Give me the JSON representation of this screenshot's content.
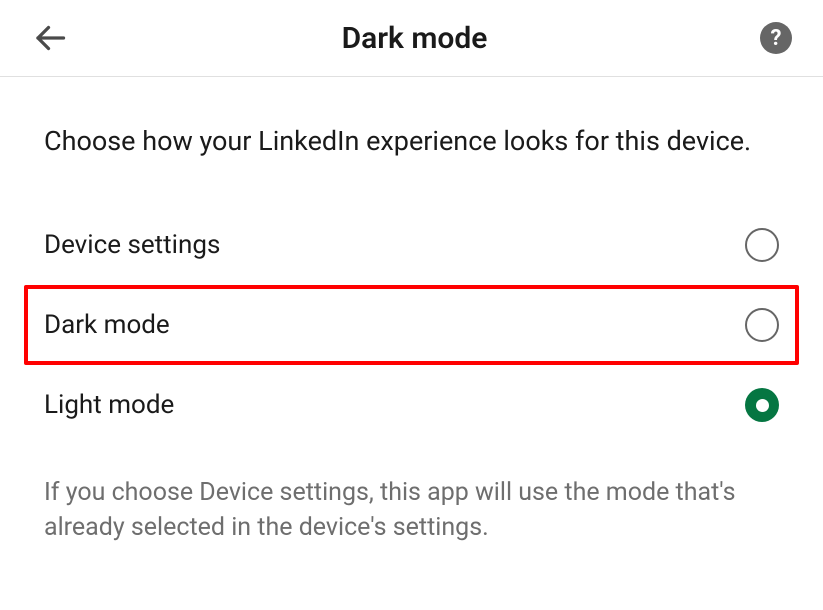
{
  "header": {
    "title": "Dark mode"
  },
  "main": {
    "description": "Choose how your LinkedIn experience looks for this device.",
    "options": [
      {
        "label": "Device settings",
        "selected": false,
        "highlighted": false
      },
      {
        "label": "Dark mode",
        "selected": false,
        "highlighted": true
      },
      {
        "label": "Light mode",
        "selected": true,
        "highlighted": false
      }
    ],
    "footnote": "If you choose Device settings, this app will use the mode that's already selected in the device's settings."
  }
}
